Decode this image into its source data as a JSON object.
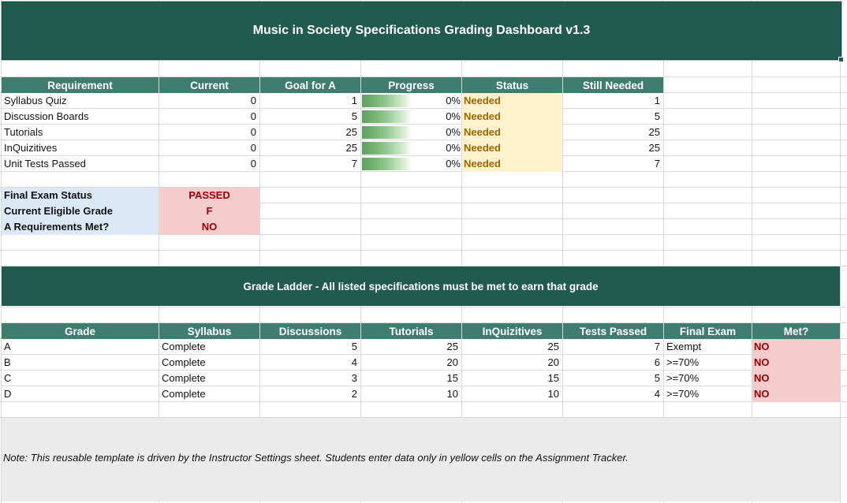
{
  "title": "Music in Society Specifications Grading Dashboard v1.3",
  "requirements": {
    "headers": [
      "Requirement",
      "Current",
      "Goal for A",
      "Progress",
      "Status",
      "Still Needed"
    ],
    "rows": [
      {
        "name": "Syllabus Quiz",
        "current": "0",
        "goal": "1",
        "progress": 0,
        "progress_label": "0%",
        "status": "Needed",
        "still_needed": "1"
      },
      {
        "name": "Discussion Boards",
        "current": "0",
        "goal": "5",
        "progress": 0,
        "progress_label": "0%",
        "status": "Needed",
        "still_needed": "5"
      },
      {
        "name": "Tutorials",
        "current": "0",
        "goal": "25",
        "progress": 0,
        "progress_label": "0%",
        "status": "Needed",
        "still_needed": "25"
      },
      {
        "name": "InQuizitives",
        "current": "0",
        "goal": "25",
        "progress": 0,
        "progress_label": "0%",
        "status": "Needed",
        "still_needed": "25"
      },
      {
        "name": "Unit Tests Passed",
        "current": "0",
        "goal": "7",
        "progress": 0,
        "progress_label": "0%",
        "status": "Needed",
        "still_needed": "7"
      }
    ]
  },
  "summary": {
    "final_exam_label": "Final Exam Status",
    "final_exam_value": "PASSED",
    "eligible_grade_label": "Current Eligible Grade",
    "eligible_grade_value": "F",
    "a_met_label": "A Requirements Met?",
    "a_met_value": "NO"
  },
  "ladder_title": "Grade Ladder - All listed specifications must be met to earn that grade",
  "ladder": {
    "headers": [
      "Grade",
      "Syllabus",
      "Discussions",
      "Tutorials",
      "InQuizitives",
      "Tests Passed",
      "Final Exam",
      "Met?"
    ],
    "rows": [
      {
        "grade": "A",
        "syllabus": "Complete",
        "discussions": "5",
        "tutorials": "25",
        "inquizitives": "25",
        "tests": "7",
        "final": "Exempt",
        "met": "NO"
      },
      {
        "grade": "B",
        "syllabus": "Complete",
        "discussions": "4",
        "tutorials": "20",
        "inquizitives": "20",
        "tests": "6",
        "final": ">=70%",
        "met": "NO"
      },
      {
        "grade": "C",
        "syllabus": "Complete",
        "discussions": "3",
        "tutorials": "15",
        "inquizitives": "15",
        "tests": "5",
        "final": ">=70%",
        "met": "NO"
      },
      {
        "grade": "D",
        "syllabus": "Complete",
        "discussions": "2",
        "tutorials": "10",
        "inquizitives": "10",
        "tests": "4",
        "final": ">=70%",
        "met": "NO"
      }
    ]
  },
  "note": "Note: This reusable template is driven by the Instructor Settings sheet. Students enter data only in yellow cells on the Assignment Tracker.",
  "colors": {
    "banner": "#215a4f",
    "header": "#3f7d70",
    "status_fill": "#fff2cc",
    "status_text": "#9c6500",
    "alert_fill": "#f4cccc",
    "alert_text": "#9c0006",
    "label_fill": "#dbe8f5",
    "note_fill": "#ebebeb"
  }
}
